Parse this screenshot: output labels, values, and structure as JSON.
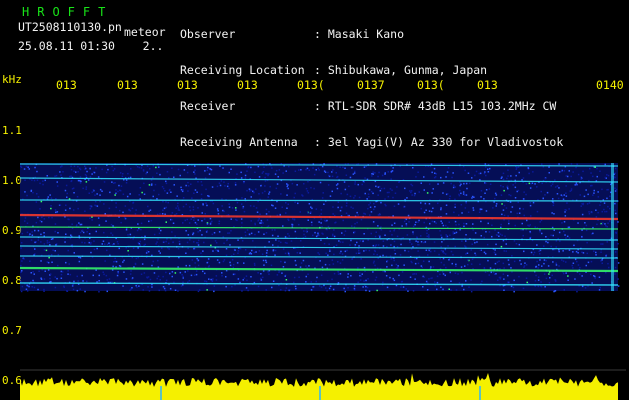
{
  "header": {
    "title": "HROFFT",
    "filename": "UT2508110130.pn",
    "tag": "meteor",
    "datetime": "25.08.11 01:30",
    "extra": "2.."
  },
  "info": [
    {
      "label": "Observer",
      "value": ": Masaki Kano"
    },
    {
      "label": "Receiving Location",
      "value": ": Shibukawa, Gunma, Japan"
    },
    {
      "label": "Receiver",
      "value": ": RTL-SDR SDR# 43dB L15 103.2MHz CW"
    },
    {
      "label": "Receiving Antenna",
      "value": ": 3el Yagi(V) Az 330 for Vladivostok"
    }
  ],
  "axes": {
    "y_unit": "kHz",
    "y_ticks": [
      "1.1",
      "1.0",
      "0.9",
      "0.8",
      "0.7",
      "0.6"
    ],
    "x_ticks": [
      "013",
      "013",
      "013",
      "013",
      "013(",
      "0137",
      "013(",
      "013",
      "0140"
    ]
  },
  "colors": {
    "background": "#000000",
    "text_white": "#f2f2f2",
    "text_yellow": "#f7f200",
    "title_green": "#18e418",
    "noise_dark": "#0a1a9c",
    "noise_mid": "#2a55ff",
    "band_cyan": "#33e6ff",
    "band_green": "#37ff6a",
    "band_red": "#ff3a2a",
    "level_yellow": "#f5f000",
    "tick_cyan": "#29b3ff"
  }
}
